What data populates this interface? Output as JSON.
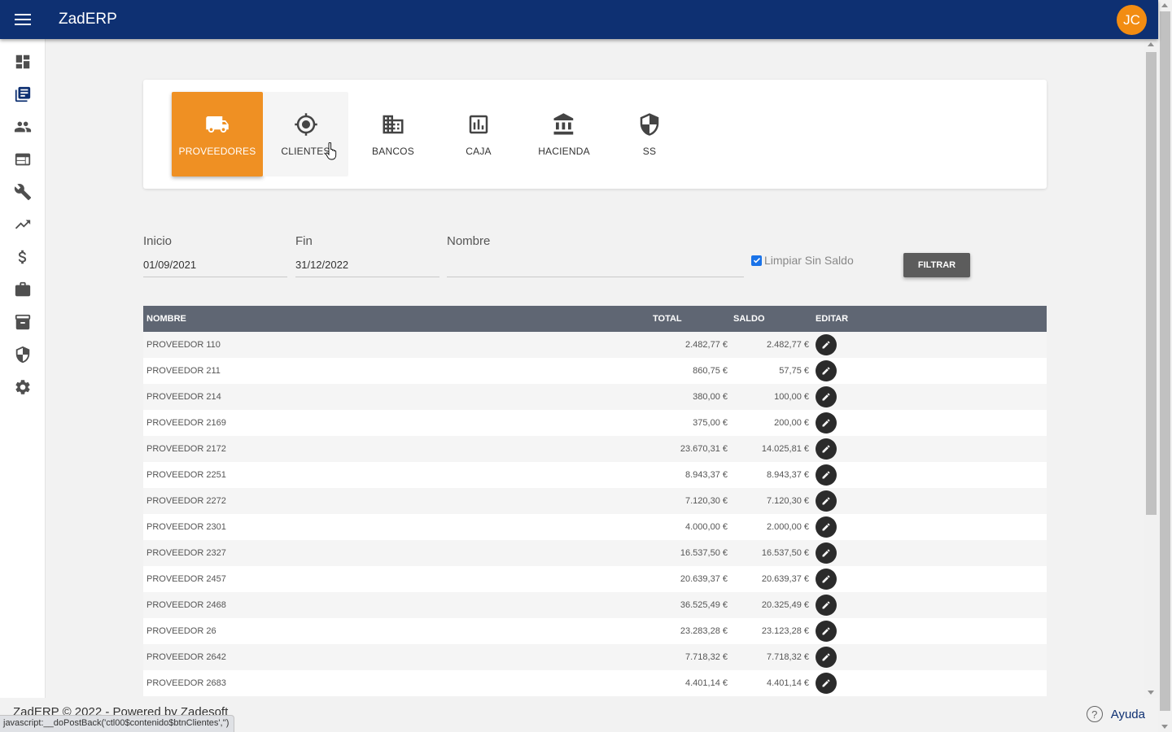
{
  "app": {
    "title": "ZadERP",
    "user_initials": "JC"
  },
  "sidebar": {
    "items": [
      {
        "icon": "dashboard-icon"
      },
      {
        "icon": "library-books-icon"
      },
      {
        "icon": "people-icon"
      },
      {
        "icon": "web-window-icon"
      },
      {
        "icon": "wrench-icon"
      },
      {
        "icon": "trending-up-icon"
      },
      {
        "icon": "dollar-icon"
      },
      {
        "icon": "briefcase-icon"
      },
      {
        "icon": "archive-icon"
      },
      {
        "icon": "shield-icon"
      },
      {
        "icon": "gear-icon"
      }
    ]
  },
  "tabs": [
    {
      "label": "PROVEEDORES",
      "icon": "truck-icon",
      "active": true
    },
    {
      "label": "CLIENTES",
      "icon": "target-icon",
      "active": false
    },
    {
      "label": "BANCOS",
      "icon": "city-icon",
      "active": false
    },
    {
      "label": "CAJA",
      "icon": "bar-chart-icon",
      "active": false
    },
    {
      "label": "HACIENDA",
      "icon": "bank-icon",
      "active": false
    },
    {
      "label": "SS",
      "icon": "shield-icon",
      "active": false
    }
  ],
  "filters": {
    "inicio_label": "Inicio",
    "inicio_value": "01/09/2021",
    "fin_label": "Fin",
    "fin_value": "31/12/2022",
    "nombre_label": "Nombre",
    "nombre_value": "",
    "limpiar_label": "Limpiar Sin Saldo",
    "limpiar_checked": true,
    "filter_button": "FILTRAR"
  },
  "table": {
    "columns": [
      "NOMBRE",
      "TOTAL",
      "SALDO",
      "EDITAR"
    ],
    "rows": [
      {
        "nombre": "PROVEEDOR 110",
        "total": "2.482,77 €",
        "saldo": "2.482,77 €"
      },
      {
        "nombre": "PROVEEDOR 211",
        "total": "860,75 €",
        "saldo": "57,75 €"
      },
      {
        "nombre": "PROVEEDOR 214",
        "total": "380,00 €",
        "saldo": "100,00 €"
      },
      {
        "nombre": "PROVEEDOR 2169",
        "total": "375,00 €",
        "saldo": "200,00 €"
      },
      {
        "nombre": "PROVEEDOR 2172",
        "total": "23.670,31 €",
        "saldo": "14.025,81 €"
      },
      {
        "nombre": "PROVEEDOR 2251",
        "total": "8.943,37 €",
        "saldo": "8.943,37 €"
      },
      {
        "nombre": "PROVEEDOR 2272",
        "total": "7.120,30 €",
        "saldo": "7.120,30 €"
      },
      {
        "nombre": "PROVEEDOR 2301",
        "total": "4.000,00 €",
        "saldo": "2.000,00 €"
      },
      {
        "nombre": "PROVEEDOR 2327",
        "total": "16.537,50 €",
        "saldo": "16.537,50 €"
      },
      {
        "nombre": "PROVEEDOR 2457",
        "total": "20.639,37 €",
        "saldo": "20.639,37 €"
      },
      {
        "nombre": "PROVEEDOR 2468",
        "total": "36.525,49 €",
        "saldo": "20.325,49 €"
      },
      {
        "nombre": "PROVEEDOR 26",
        "total": "23.283,28 €",
        "saldo": "23.123,28 €"
      },
      {
        "nombre": "PROVEEDOR 2642",
        "total": "7.718,32 €",
        "saldo": "7.718,32 €"
      },
      {
        "nombre": "PROVEEDOR 2683",
        "total": "4.401,14 €",
        "saldo": "4.401,14 €"
      }
    ]
  },
  "footer": {
    "copyright": "ZadERP © 2022 - Powered by Zadesoft",
    "help_label": "Ayuda"
  },
  "status_bar": {
    "url": "javascript:__doPostBack('ctl00$contenido$btnClientes','')"
  },
  "colors": {
    "topbar": "#0e3072",
    "accent": "#ef9023",
    "table_header": "#5f6673"
  }
}
